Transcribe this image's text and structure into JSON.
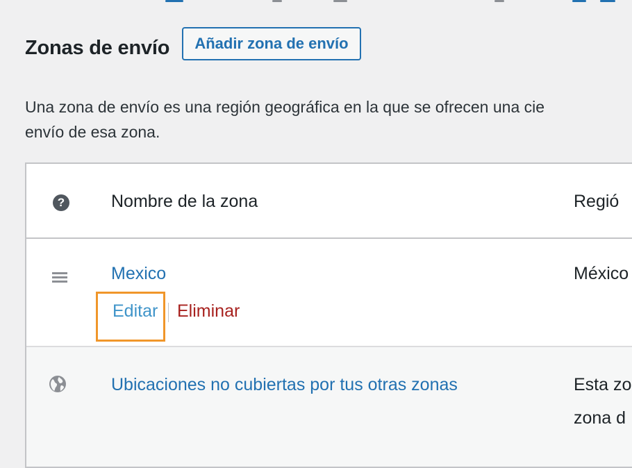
{
  "header": {
    "title": "Zonas de envío",
    "add_zone_label": "Añadir zona de envío"
  },
  "description": {
    "line1": "Una zona de envío es una región geográfica en la que se ofrecen una cie",
    "line2": "envío de esa zona."
  },
  "table": {
    "columns": {
      "zone_name": "Nombre de la zona",
      "region": "Regió"
    },
    "rows": [
      {
        "name": "Mexico",
        "region": "México",
        "actions": {
          "edit": "Editar",
          "delete": "Eliminar"
        }
      },
      {
        "name": "Ubicaciones no cubiertas por tus otras zonas",
        "region_line1": "Esta zo",
        "region_line2": "zona d"
      }
    ]
  },
  "colors": {
    "accent": "#2271b1",
    "delete": "#a7211e",
    "highlight": "#f0962a",
    "background": "#f0f0f1"
  },
  "icons": {
    "help": "help-icon",
    "drag": "menu-icon",
    "globe": "globe-icon"
  }
}
